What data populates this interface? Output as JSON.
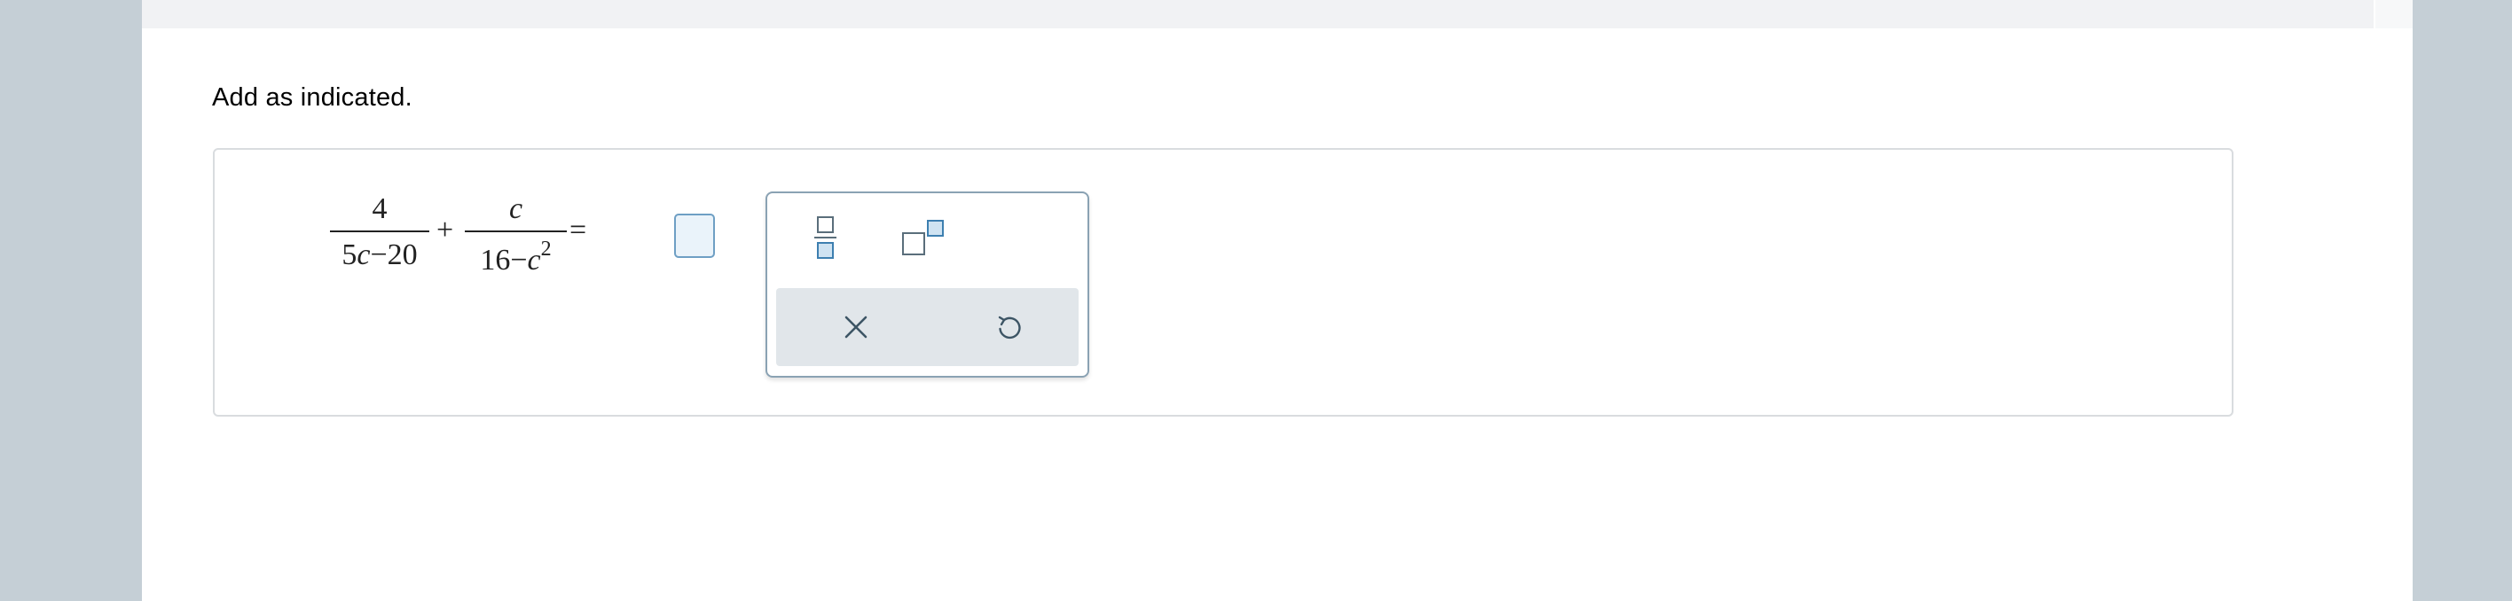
{
  "instruction": "Add as indicated.",
  "expression": {
    "fraction1": {
      "numerator": "4",
      "den_a": "5",
      "den_var": "c",
      "den_op": "−",
      "den_b": "20"
    },
    "plus": "+",
    "fraction2": {
      "num_var": "c",
      "den_a": "16",
      "den_op": "−",
      "den_var": "c",
      "den_exp": "2"
    },
    "equals": "="
  },
  "answer": {
    "value": ""
  },
  "palette": {
    "tools": [
      {
        "name": "fraction",
        "icon": "fraction-template-icon"
      },
      {
        "name": "exponent",
        "icon": "superscript-template-icon"
      }
    ],
    "actions": [
      {
        "name": "clear",
        "icon": "close-icon"
      },
      {
        "name": "undo",
        "icon": "undo-icon"
      }
    ]
  },
  "colors": {
    "page_bg": "#c5cfd6",
    "card_bg": "#ffffff",
    "answer_border": "#6e9fc4",
    "answer_fill": "#eaf3fa",
    "palette_border": "#8aa2b3",
    "action_bar": "#e1e6ea",
    "icon": "#3d5565"
  }
}
